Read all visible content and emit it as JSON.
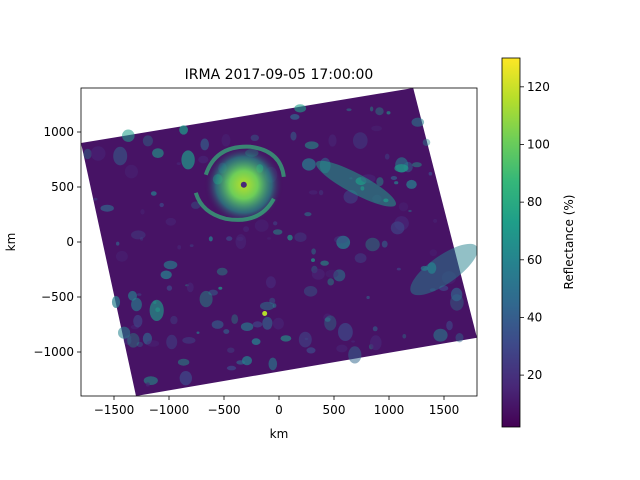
{
  "chart_data": {
    "type": "heatmap",
    "title": "IRMA 2017-09-05 17:00:00",
    "xlabel": "km",
    "ylabel": "km",
    "xlim": [
      -1800,
      1800
    ],
    "ylim": [
      -1400,
      1400
    ],
    "xticks": [
      -1500,
      -1000,
      -500,
      0,
      500,
      1000,
      1500
    ],
    "xtick_labels": [
      "−1500",
      "−1000",
      "−500",
      "0",
      "500",
      "1000",
      "1500"
    ],
    "yticks": [
      1000,
      500,
      0,
      -500,
      -1000
    ],
    "ytick_labels": [
      "1000",
      "500",
      "0",
      "−500",
      "−1000"
    ],
    "colorbar": {
      "label": "Reflectance (%)",
      "colormap": "viridis",
      "range": [
        2,
        130
      ],
      "ticks": [
        20,
        40,
        60,
        80,
        100,
        120
      ],
      "tick_labels": [
        "20",
        "40",
        "60",
        "80",
        "100",
        "120"
      ]
    },
    "swath_corners_km": [
      [
        -1800,
        900
      ],
      [
        1220,
        1400
      ],
      [
        1800,
        -870
      ],
      [
        -1300,
        -1400
      ]
    ],
    "features": [
      {
        "name": "hurricane eye",
        "x": -320,
        "y": 520
      },
      {
        "name": "bright spot",
        "x": -130,
        "y": -650
      }
    ],
    "grid": false
  },
  "colors": {
    "viridis": [
      "#440154",
      "#482878",
      "#3e4989",
      "#31688e",
      "#26828e",
      "#1f9e89",
      "#35b779",
      "#6ece58",
      "#b5de2b",
      "#fde725"
    ],
    "background": "#ffffff"
  }
}
